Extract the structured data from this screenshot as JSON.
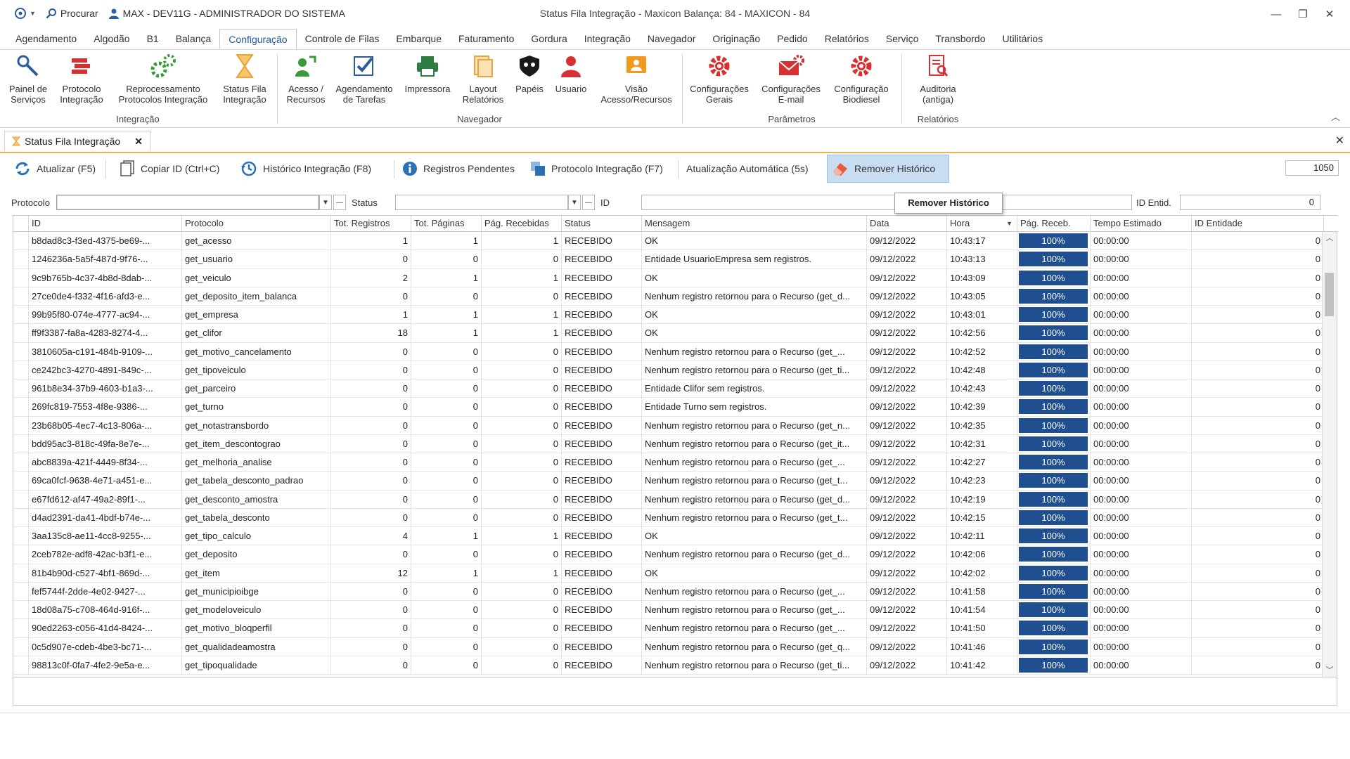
{
  "window": {
    "app_menu_icon": "logo-icon",
    "search_label": "Procurar",
    "user_label": "MAX - DEV11G - ADMINISTRADOR DO SISTEMA",
    "title": "Status Fila Integração - Maxicon Balança: 84 - MAXICON - 84"
  },
  "menu_tabs": [
    "Agendamento",
    "Algodão",
    "B1",
    "Balança",
    "Configuração",
    "Controle de Filas",
    "Embarque",
    "Faturamento",
    "Gordura",
    "Integração",
    "Navegador",
    "Originação",
    "Pedido",
    "Relatórios",
    "Serviço",
    "Transbordo",
    "Utilitários"
  ],
  "ribbon": {
    "groups": {
      "integracao": "Integração",
      "navegador": "Navegador",
      "parametros": "Parâmetros",
      "relatorios": "Relatórios"
    },
    "buttons": {
      "painel": "Painel de\nServiços",
      "protocolo": "Protocolo\nIntegração",
      "reprocessamento": "Reprocessamento\nProtocolos Integração",
      "status_fila": "Status Fila\nIntegração",
      "acesso": "Acesso /\nRecursos",
      "agendamento": "Agendamento\nde Tarefas",
      "impressora": "Impressora",
      "layout": "Layout\nRelatórios",
      "papeis": "Papéis",
      "usuario": "Usuario",
      "visao": "Visão\nAcesso/Recursos",
      "config_gerais": "Configurações\nGerais",
      "config_email": "Configurações\nE-mail",
      "config_biodiesel": "Configuração\nBiodiesel",
      "auditoria": "Auditoria\n(antiga)"
    }
  },
  "doc_tab": {
    "label": "Status Fila Integração"
  },
  "toolbar": {
    "atualizar": "Atualizar (F5)",
    "copiar": "Copiar ID (Ctrl+C)",
    "historico": "Histórico Integração (F8)",
    "pendentes": "Registros Pendentes",
    "protocolo": "Protocolo Integração (F7)",
    "auto": "Atualização Automática (5s)",
    "remover": "Remover Histórico",
    "count": "1050"
  },
  "filters": {
    "protocolo_label": "Protocolo",
    "status_label": "Status",
    "id_label": "ID",
    "id_entid_label": "ID Entid.",
    "id_entid_value": "0"
  },
  "tooltip": "Remover Histórico",
  "colors": {
    "progress": "#1f4f8f",
    "active_tab": "#1e5aa8",
    "tab_underline": "#e6b34d"
  },
  "grid": {
    "headers": [
      "ID",
      "Protocolo",
      "Tot. Registros",
      "Tot. Páginas",
      "Pág. Recebidas",
      "Status",
      "Mensagem",
      "Data",
      "Hora",
      "Pág. Receb.",
      "Tempo Estimado",
      "ID Entidade"
    ],
    "rows": [
      [
        "b8dad8c3-f3ed-4375-be69-...",
        "get_acesso",
        "1",
        "1",
        "1",
        "RECEBIDO",
        "OK",
        "09/12/2022",
        "10:43:17",
        "100%",
        "00:00:00",
        "0"
      ],
      [
        "1246236a-5a5f-487d-9f76-...",
        "get_usuario",
        "0",
        "0",
        "0",
        "RECEBIDO",
        "Entidade UsuarioEmpresa sem registros.",
        "09/12/2022",
        "10:43:13",
        "100%",
        "00:00:00",
        "0"
      ],
      [
        "9c9b765b-4c37-4b8d-8dab-...",
        "get_veiculo",
        "2",
        "1",
        "1",
        "RECEBIDO",
        "OK",
        "09/12/2022",
        "10:43:09",
        "100%",
        "00:00:00",
        "0"
      ],
      [
        "27ce0de4-f332-4f16-afd3-e...",
        "get_deposito_item_balanca",
        "0",
        "0",
        "0",
        "RECEBIDO",
        "Nenhum registro retornou para o Recurso (get_d...",
        "09/12/2022",
        "10:43:05",
        "100%",
        "00:00:00",
        "0"
      ],
      [
        "99b95f80-074e-4777-ac94-...",
        "get_empresa",
        "1",
        "1",
        "1",
        "RECEBIDO",
        "OK",
        "09/12/2022",
        "10:43:01",
        "100%",
        "00:00:00",
        "0"
      ],
      [
        "ff9f3387-fa8a-4283-8274-4...",
        "get_clifor",
        "18",
        "1",
        "1",
        "RECEBIDO",
        "OK",
        "09/12/2022",
        "10:42:56",
        "100%",
        "00:00:00",
        "0"
      ],
      [
        "3810605a-c191-484b-9109-...",
        "get_motivo_cancelamento",
        "0",
        "0",
        "0",
        "RECEBIDO",
        "Nenhum registro retornou para o Recurso (get_...",
        "09/12/2022",
        "10:42:52",
        "100%",
        "00:00:00",
        "0"
      ],
      [
        "ce242bc3-4270-4891-849c-...",
        "get_tipoveiculo",
        "0",
        "0",
        "0",
        "RECEBIDO",
        "Nenhum registro retornou para o Recurso (get_ti...",
        "09/12/2022",
        "10:42:48",
        "100%",
        "00:00:00",
        "0"
      ],
      [
        "961b8e34-37b9-4603-b1a3-...",
        "get_parceiro",
        "0",
        "0",
        "0",
        "RECEBIDO",
        "Entidade Clifor sem registros.",
        "09/12/2022",
        "10:42:43",
        "100%",
        "00:00:00",
        "0"
      ],
      [
        "269fc819-7553-4f8e-9386-...",
        "get_turno",
        "0",
        "0",
        "0",
        "RECEBIDO",
        "Entidade Turno sem registros.",
        "09/12/2022",
        "10:42:39",
        "100%",
        "00:00:00",
        "0"
      ],
      [
        "23b68b05-4ec7-4c13-806a-...",
        "get_notastransbordo",
        "0",
        "0",
        "0",
        "RECEBIDO",
        "Nenhum registro retornou para o Recurso (get_n...",
        "09/12/2022",
        "10:42:35",
        "100%",
        "00:00:00",
        "0"
      ],
      [
        "bdd95ac3-818c-49fa-8e7e-...",
        "get_item_descontograo",
        "0",
        "0",
        "0",
        "RECEBIDO",
        "Nenhum registro retornou para o Recurso (get_it...",
        "09/12/2022",
        "10:42:31",
        "100%",
        "00:00:00",
        "0"
      ],
      [
        "abc8839a-421f-4449-8f34-...",
        "get_melhoria_analise",
        "0",
        "0",
        "0",
        "RECEBIDO",
        "Nenhum registro retornou para o Recurso (get_...",
        "09/12/2022",
        "10:42:27",
        "100%",
        "00:00:00",
        "0"
      ],
      [
        "69ca0fcf-9638-4e71-a451-e...",
        "get_tabela_desconto_padrao",
        "0",
        "0",
        "0",
        "RECEBIDO",
        "Nenhum registro retornou para o Recurso (get_t...",
        "09/12/2022",
        "10:42:23",
        "100%",
        "00:00:00",
        "0"
      ],
      [
        "e67fd612-af47-49a2-89f1-...",
        "get_desconto_amostra",
        "0",
        "0",
        "0",
        "RECEBIDO",
        "Nenhum registro retornou para o Recurso (get_d...",
        "09/12/2022",
        "10:42:19",
        "100%",
        "00:00:00",
        "0"
      ],
      [
        "d4ad2391-da41-4bdf-b74e-...",
        "get_tabela_desconto",
        "0",
        "0",
        "0",
        "RECEBIDO",
        "Nenhum registro retornou para o Recurso (get_t...",
        "09/12/2022",
        "10:42:15",
        "100%",
        "00:00:00",
        "0"
      ],
      [
        "3aa135c8-ae11-4cc8-9255-...",
        "get_tipo_calculo",
        "4",
        "1",
        "1",
        "RECEBIDO",
        "OK",
        "09/12/2022",
        "10:42:11",
        "100%",
        "00:00:00",
        "0"
      ],
      [
        "2ceb782e-adf8-42ac-b3f1-e...",
        "get_deposito",
        "0",
        "0",
        "0",
        "RECEBIDO",
        "Nenhum registro retornou para o Recurso (get_d...",
        "09/12/2022",
        "10:42:06",
        "100%",
        "00:00:00",
        "0"
      ],
      [
        "81b4b90d-c527-4bf1-869d-...",
        "get_item",
        "12",
        "1",
        "1",
        "RECEBIDO",
        "OK",
        "09/12/2022",
        "10:42:02",
        "100%",
        "00:00:00",
        "0"
      ],
      [
        "fef5744f-2dde-4e02-9427-...",
        "get_municipioibge",
        "0",
        "0",
        "0",
        "RECEBIDO",
        "Nenhum registro retornou para o Recurso (get_...",
        "09/12/2022",
        "10:41:58",
        "100%",
        "00:00:00",
        "0"
      ],
      [
        "18d08a75-c708-464d-916f-...",
        "get_modeloveiculo",
        "0",
        "0",
        "0",
        "RECEBIDO",
        "Nenhum registro retornou para o Recurso (get_...",
        "09/12/2022",
        "10:41:54",
        "100%",
        "00:00:00",
        "0"
      ],
      [
        "90ed2263-c056-41d4-8424-...",
        "get_motivo_bloqperfil",
        "0",
        "0",
        "0",
        "RECEBIDO",
        "Nenhum registro retornou para o Recurso (get_...",
        "09/12/2022",
        "10:41:50",
        "100%",
        "00:00:00",
        "0"
      ],
      [
        "0c5d907e-cdeb-4be3-bc71-...",
        "get_qualidadeamostra",
        "0",
        "0",
        "0",
        "RECEBIDO",
        "Nenhum registro retornou para o Recurso (get_q...",
        "09/12/2022",
        "10:41:46",
        "100%",
        "00:00:00",
        "0"
      ],
      [
        "98813c0f-0fa7-4fe2-9e5a-e...",
        "get_tipoqualidade",
        "0",
        "0",
        "0",
        "RECEBIDO",
        "Nenhum registro retornou para o Recurso (get_ti...",
        "09/12/2022",
        "10:41:42",
        "100%",
        "00:00:00",
        "0"
      ]
    ]
  }
}
